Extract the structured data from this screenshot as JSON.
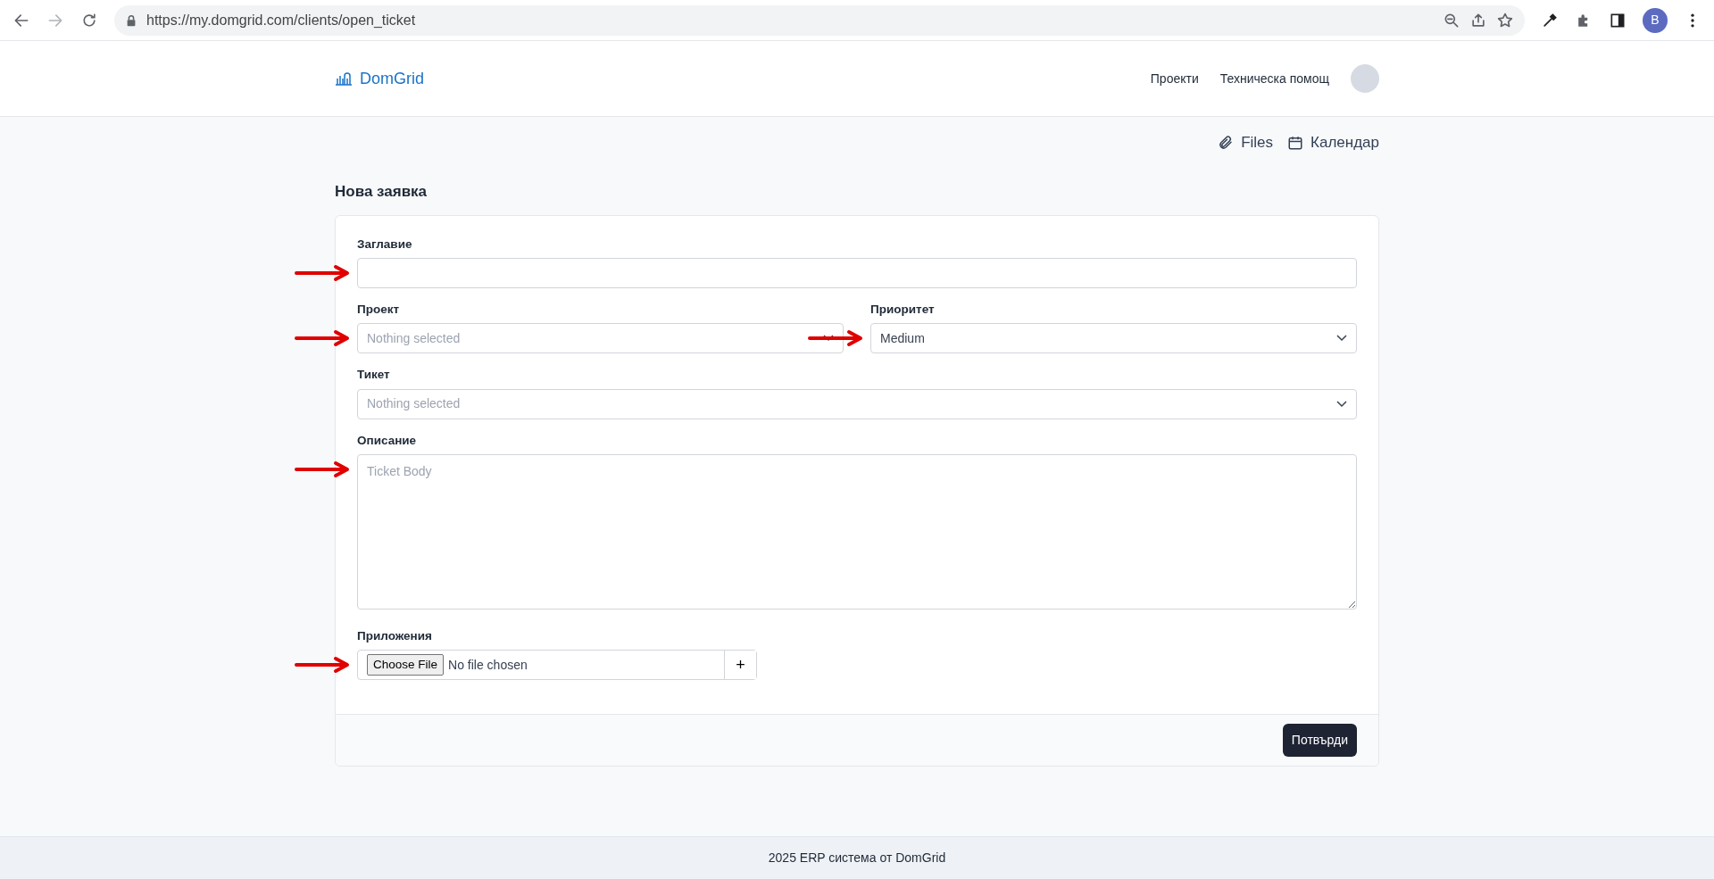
{
  "browser": {
    "url": "https://my.domgrid.com/clients/open_ticket",
    "profile_initial": "B"
  },
  "header": {
    "logo": "DomGrid",
    "nav": [
      {
        "label": "Проекти"
      },
      {
        "label": "Техническа помощ"
      }
    ]
  },
  "toolbar": [
    {
      "label": "Files",
      "kind": "files"
    },
    {
      "label": "Календар",
      "kind": "calendar"
    }
  ],
  "page_title": "Нова заявка",
  "form": {
    "rows": [
      [
        {
          "label": "Заглавие",
          "kind": "text",
          "annotated": true
        }
      ],
      [
        {
          "label": "Проект",
          "kind": "select",
          "placeholder": "Nothing selected",
          "annotated": true
        },
        {
          "label": "Приоритет",
          "kind": "select",
          "value": "Medium",
          "annotated": true
        }
      ],
      [
        {
          "label": "Тикет",
          "kind": "select",
          "placeholder": "Nothing selected"
        }
      ],
      [
        {
          "label": "Описание",
          "kind": "textarea",
          "placeholder": "Ticket Body",
          "annotated": true
        }
      ],
      [
        {
          "label": "Приложения",
          "kind": "file",
          "button": "Choose File",
          "status": "No file chosen",
          "add": "+",
          "annotated": true
        }
      ]
    ],
    "submit": "Потвърди"
  },
  "footer": "2025 ERP система от DomGrid"
}
